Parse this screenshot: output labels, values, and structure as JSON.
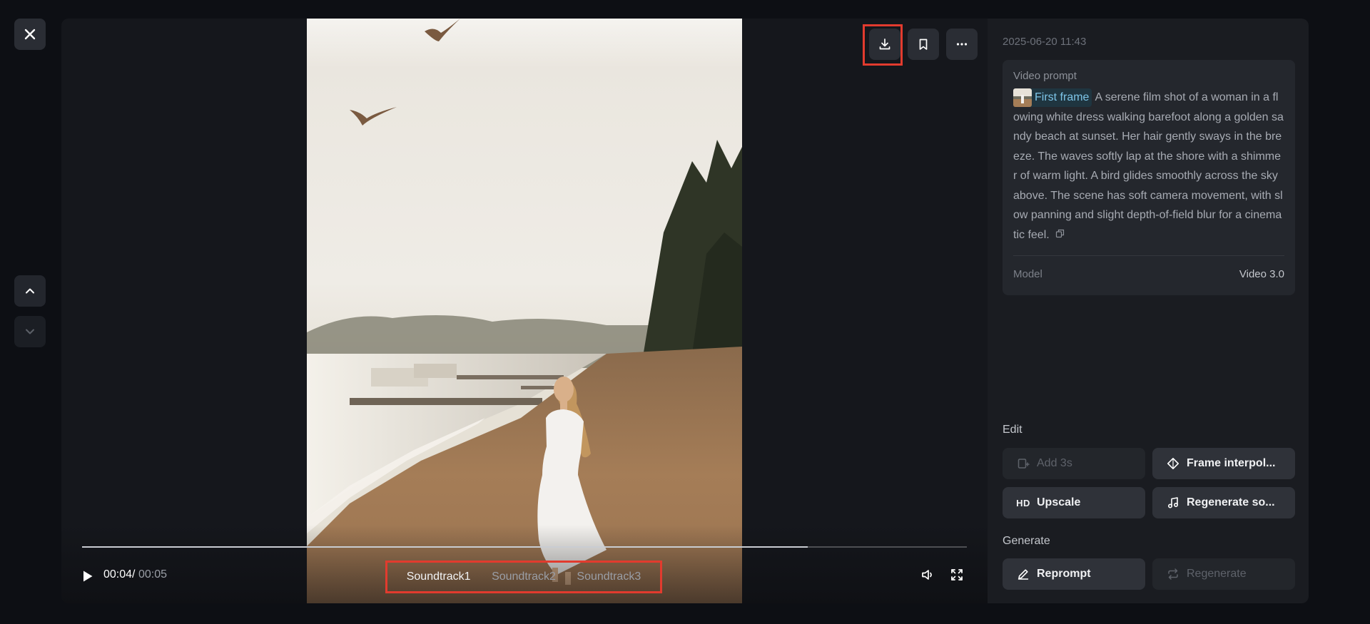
{
  "colors": {
    "background": "#0d0f14",
    "panel": "#1a1c21",
    "highlight": "#e23b2e",
    "chip_text": "#7dc5e8"
  },
  "nav": {
    "close_icon": "close-icon",
    "up_icon": "chevron-up-icon",
    "down_icon": "chevron-down-icon"
  },
  "top_actions": [
    {
      "icon": "download-icon",
      "highlighted": true
    },
    {
      "icon": "bookmark-icon",
      "highlighted": false
    },
    {
      "icon": "more-icon",
      "highlighted": false
    }
  ],
  "player": {
    "current_time": "00:04",
    "separator": "/",
    "total_time": "00:05",
    "progress_fraction": 0.82,
    "soundtracks": [
      "Soundtrack1",
      "Soundtrack2",
      "Soundtrack3"
    ],
    "active_soundtrack": 0
  },
  "panel": {
    "date": "2025-06-20 11:43",
    "prompt_label": "Video prompt",
    "first_frame_label": "First frame",
    "prompt_text": "A serene film shot of a woman in a flowing white dress walking barefoot along a golden sandy beach at sunset. Her hair gently sways in the breeze. The waves softly lap at the shore with a shimmer of warm light. A bird glides smoothly across the sky above. The scene has soft camera movement, with slow panning and slight depth-of-field blur for a cinematic feel.",
    "model_label": "Model",
    "model_value": "Video 3.0",
    "edit_label": "Edit",
    "generate_label": "Generate",
    "buttons": {
      "add": "Add 3s",
      "frame_interpolation": "Frame interpol...",
      "hd_badge": "HD",
      "upscale": "Upscale",
      "regenerate_sound": "Regenerate so...",
      "reprompt": "Reprompt",
      "regenerate": "Regenerate"
    }
  }
}
